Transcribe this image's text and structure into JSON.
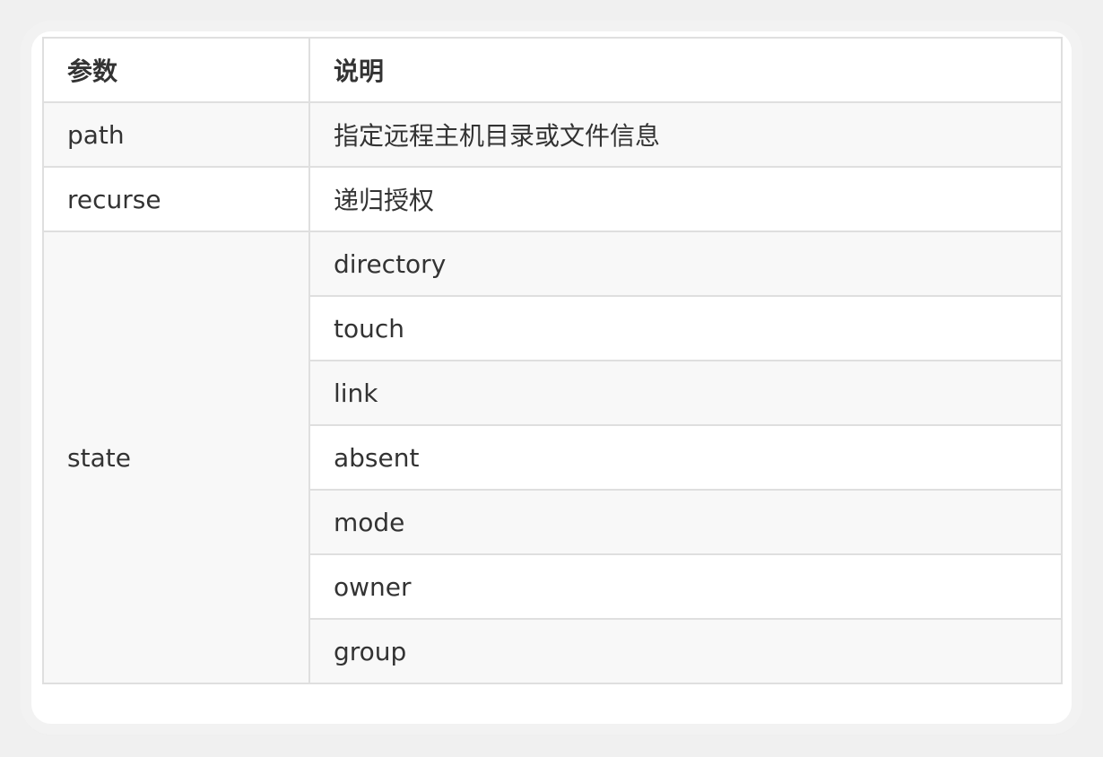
{
  "table": {
    "headers": [
      "参数",
      "说明"
    ],
    "rows": [
      {
        "param": "path",
        "desc": "指定远程主机目录或文件信息"
      },
      {
        "param": "recurse",
        "desc": "递归授权"
      }
    ],
    "state": {
      "param": "state",
      "values": [
        "directory",
        "touch",
        "link",
        "absent",
        "mode",
        "owner",
        "group"
      ]
    }
  }
}
